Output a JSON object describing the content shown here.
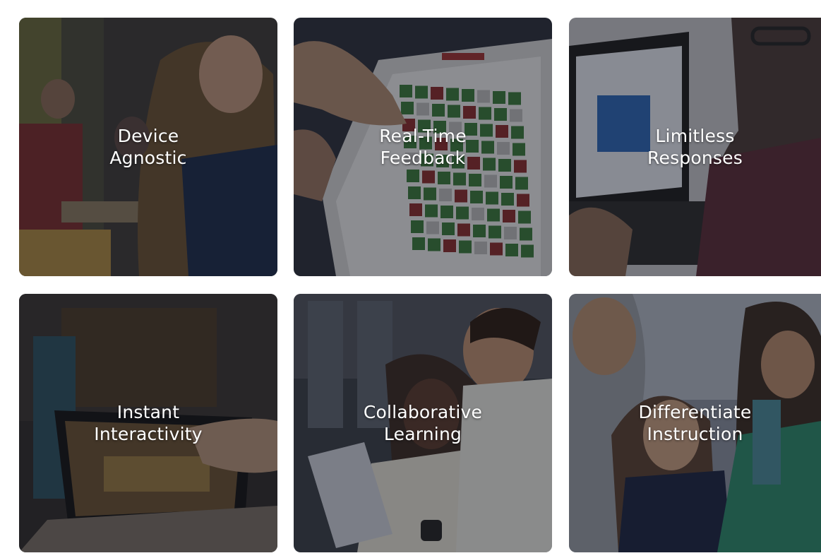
{
  "tiles": [
    {
      "line1": "Device",
      "line2": "Agnostic"
    },
    {
      "line1": "Real-Time",
      "line2": "Feedback"
    },
    {
      "line1": "Limitless",
      "line2": "Responses"
    },
    {
      "line1": "Instant",
      "line2": "Interactivity"
    },
    {
      "line1": "Collaborative",
      "line2": "Learning"
    },
    {
      "line1": "Differentiate",
      "line2": "Instruction"
    }
  ],
  "colors": {
    "overlay": "#14161e",
    "caption": "#ffffff",
    "grid_green": "#3a7a3a",
    "grid_red": "#8a2a2a"
  }
}
